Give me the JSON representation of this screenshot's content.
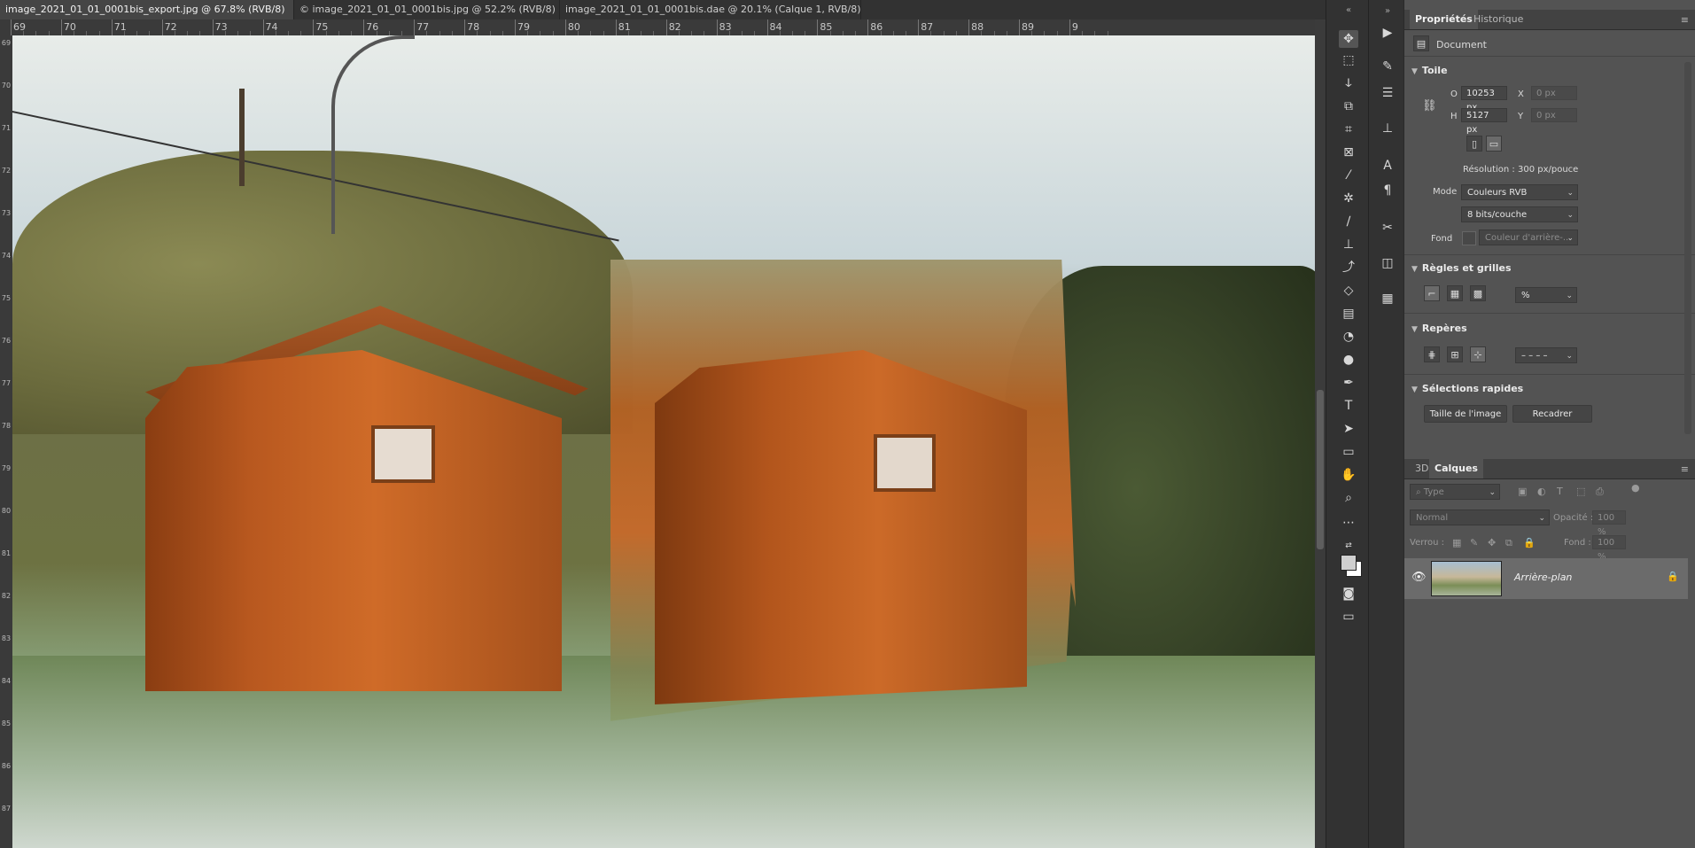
{
  "tabs": [
    {
      "label": "image_2021_01_01_0001bis_export.jpg @ 67.8% (RVB/8)",
      "close": "×",
      "active": true
    },
    {
      "label": "© image_2021_01_01_0001bis.jpg @ 52.2% (RVB/8)",
      "close": "×",
      "active": false
    },
    {
      "label": "image_2021_01_01_0001bis.dae @ 20.1% (Calque 1, RVB/8) *",
      "close": "×",
      "active": false
    }
  ],
  "ruler_top": [
    "69",
    "70",
    "71",
    "72",
    "73",
    "74",
    "75",
    "76",
    "77",
    "78",
    "79",
    "80",
    "81",
    "82",
    "83",
    "84",
    "85",
    "86",
    "87",
    "88",
    "89",
    "9"
  ],
  "ruler_left": [
    "69",
    "70",
    "71",
    "72",
    "73",
    "74",
    "75",
    "76",
    "77",
    "78",
    "79",
    "80",
    "81",
    "82",
    "83",
    "84",
    "85",
    "86",
    "87"
  ],
  "properties": {
    "tab_properties": "Propriétés",
    "tab_history": "Historique",
    "doc_label": "Document",
    "canvas_section": "Toile",
    "w_label": "O",
    "w_value": "10253 px",
    "h_label": "H",
    "h_value": "5127 px",
    "x_label": "X",
    "x_value": "0 px",
    "y_label": "Y",
    "y_value": "0 px",
    "resolution": "Résolution : 300 px/pouce",
    "mode_label": "Mode",
    "mode_value": "Couleurs RVB",
    "bits_value": "8 bits/couche",
    "fond_label": "Fond",
    "fond_value": "Couleur d'arrière-...",
    "rules_section": "Règles et grilles",
    "rules_unit": "%",
    "guides_section": "Repères",
    "guides_style": "– – – –",
    "quick_section": "Sélections rapides",
    "btn_image_size": "Taille de l'image",
    "btn_crop": "Recadrer"
  },
  "layers": {
    "tab_3d": "3D",
    "tab_layers": "Calques",
    "filter_placeholder": "Type",
    "blend_mode": "Normal",
    "opacity_label": "Opacité :",
    "opacity_value": "100 %",
    "lock_label": "Verrou :",
    "fill_label": "Fond :",
    "fill_value": "100 %",
    "layer_name": "Arrière-plan"
  },
  "colors": {
    "panel_bg": "#535353",
    "toolbar_bg": "#323232",
    "active_layer": "#6b6b6b"
  }
}
